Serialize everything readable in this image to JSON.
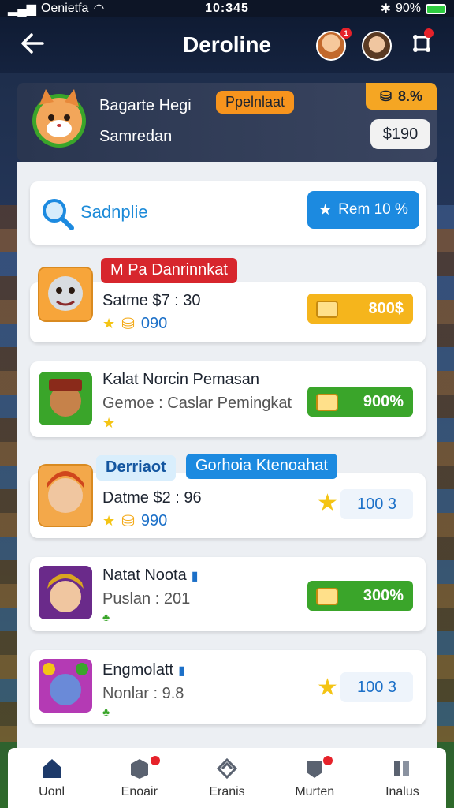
{
  "status_bar": {
    "carrier": "Oenietfa",
    "time": "10:345",
    "battery": "90%"
  },
  "header": {
    "title": "Deroline",
    "back_icon": "arrow-left-icon",
    "avatar_1_badge": "1",
    "settings_icon": "gear-icon"
  },
  "profile": {
    "name": "Bagarte Hegi",
    "tag": "Ppelnlaat",
    "subtitle": "Samredan",
    "coin_label": "8.%",
    "price": "$190"
  },
  "search": {
    "label": "Sadnplie",
    "button_label": "Rem 10 %"
  },
  "items": [
    {
      "ribbon": "M Pa Danrinnkat",
      "title": "Satme  $7 : 30",
      "sub": "090",
      "value": "800$",
      "value_style": "yellow"
    },
    {
      "title": "Kalat Norcin Pemasan",
      "sub": "Gemoe : Caslar Pemingkat",
      "value": "900%",
      "value_style": "green"
    },
    {
      "ribbon": "Derriaot",
      "ribbon_2": "Gorhoia Ktenoahat",
      "title": "Datme  $2 : 96",
      "sub": "990",
      "value": "100 3",
      "value_style": "plain"
    },
    {
      "title": "Natat Noota",
      "sub": "Puslan : 201",
      "value": "300%",
      "value_style": "green"
    },
    {
      "title": "Engmolatt",
      "sub": "Nonlar : 9.8",
      "value": "100 3",
      "value_style": "plain"
    }
  ],
  "nav": [
    {
      "label": "Uonl",
      "icon": "home-icon"
    },
    {
      "label": "Enoair",
      "icon": "box-icon"
    },
    {
      "label": "Eranis",
      "icon": "tag-icon"
    },
    {
      "label": "Murten",
      "icon": "badge-icon"
    },
    {
      "label": "Inalus",
      "icon": "grid-icon"
    }
  ],
  "colors": {
    "accent_blue": "#1c8ae0",
    "green": "#3aa52a",
    "yellow": "#f5b51c",
    "orange": "#f7941d",
    "red": "#e6222a"
  }
}
